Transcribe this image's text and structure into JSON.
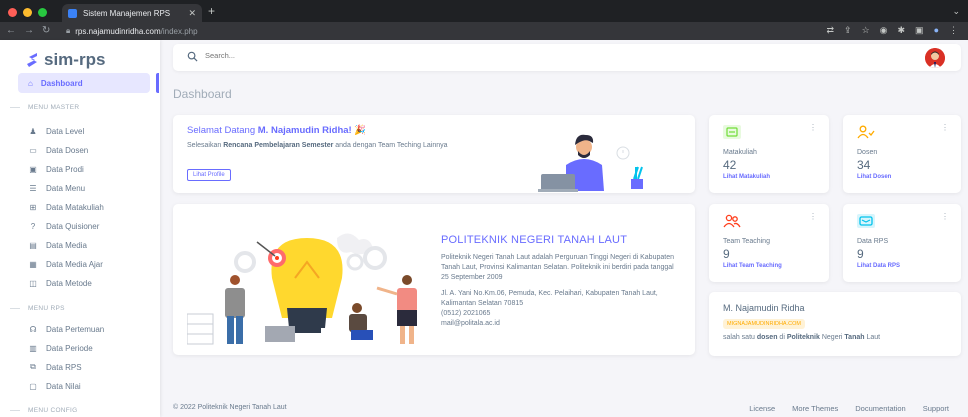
{
  "browser": {
    "tab_title": "Sistem Manajemen RPS",
    "url_host": "rps.najamudinridha.com",
    "url_path": "/index.php",
    "dots": [
      "#ff5f57",
      "#febc2e",
      "#28c840"
    ]
  },
  "sidebar": {
    "brand": "sim-rps",
    "active": {
      "label": "Dashboard",
      "icon": "home-icon"
    },
    "header_master": "MENU MASTER",
    "master_items": [
      {
        "label": "Data Level",
        "icon": "users-icon"
      },
      {
        "label": "Data Dosen",
        "icon": "book-icon"
      },
      {
        "label": "Data Prodi",
        "icon": "window-icon"
      },
      {
        "label": "Data Menu",
        "icon": "menu-icon"
      },
      {
        "label": "Data Matakuliah",
        "icon": "layers-icon"
      },
      {
        "label": "Data Quisioner",
        "icon": "question-icon"
      },
      {
        "label": "Data Media",
        "icon": "media-icon"
      },
      {
        "label": "Data Media Ajar",
        "icon": "image-icon"
      },
      {
        "label": "Data Metode",
        "icon": "method-icon"
      }
    ],
    "header_rps": "MENU RPS",
    "rps_items": [
      {
        "label": "Data Pertemuan",
        "icon": "meeting-icon"
      },
      {
        "label": "Data Periode",
        "icon": "calendar-icon"
      },
      {
        "label": "Data RPS",
        "icon": "doc-icon"
      },
      {
        "label": "Data Nilai",
        "icon": "grade-icon"
      }
    ],
    "header_config": "MENU CONFIG"
  },
  "search": {
    "placeholder": "Search..."
  },
  "page_title": "Dashboard",
  "welcome": {
    "greeting": "Selamat Datang ",
    "name": "M. Najamudin Ridha!",
    "emoji": "🎉",
    "text_pre": "Selesaikan ",
    "text_bold": "Rencana Pembelajaran Semester",
    "text_post": " anda dengan Team Teching Lainnya",
    "button": "Lihat Profile"
  },
  "institution": {
    "title": "POLITEKNIK NEGERI TANAH LAUT",
    "about": "Politeknik Negeri Tanah Laut adalah Perguruan Tinggi Negeri di Kabupaten Tanah Laut, Provinsi Kalimantan Selatan. Politeknik ini berdiri pada tanggal 25 September 2009",
    "address": "Jl. A. Yani No.Km.06, Pemuda, Kec. Pelaihari, Kabupaten Tanah Laut, Kalimantan Selatan 70815",
    "phone": "(0512) 2021065",
    "email": "mail@politala.ac.id"
  },
  "stats": [
    {
      "label": "Matakuliah",
      "value": "42",
      "link": "Lihat Matakuliah",
      "color": "#71dd37"
    },
    {
      "label": "Dosen",
      "value": "34",
      "link": "Lihat Dosen",
      "color": "#ffab00"
    },
    {
      "label": "Team Teaching",
      "value": "9",
      "link": "Lihat Team Teaching",
      "color": "#ff3e1d"
    },
    {
      "label": "Data RPS",
      "value": "9",
      "link": "Lihat Data RPS",
      "color": "#03c3ec"
    }
  ],
  "user": {
    "name": "M. Najamudin Ridha",
    "badge": "MIGNAJAMUDINRIDHA.COM",
    "desc_pre": "salah satu ",
    "desc_b1": "dosen",
    "desc_mid": " di ",
    "desc_b2": "Politeknik",
    "desc_mid2": " Negeri ",
    "desc_b3": "Tanah",
    "desc_post": " Laut"
  },
  "footer": {
    "copyright": "© 2022 Politeknik Negeri Tanah Laut",
    "links": [
      "License",
      "More Themes",
      "Documentation",
      "Support"
    ]
  }
}
